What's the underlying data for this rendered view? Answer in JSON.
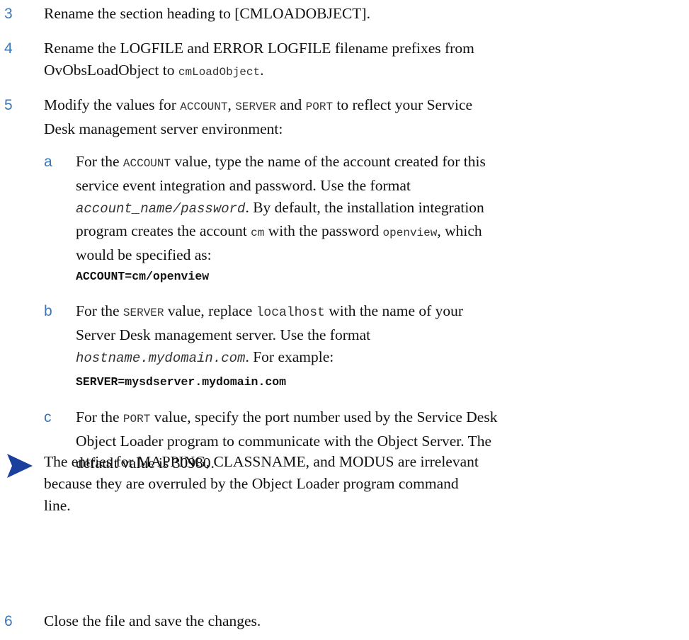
{
  "steps": [
    {
      "number": "3",
      "text_parts": [
        "Rename the section heading to [CMLOADOBJECT]."
      ]
    },
    {
      "number": "4",
      "line1": "Rename the LOGFILE and ERROR LOGFILE filename prefixes from",
      "line2_a": "OvObsLoadObject to ",
      "line2_mono": "cmLoadObject",
      "line2_b": "."
    },
    {
      "number": "5",
      "l1_a": "Modify the values for ",
      "l1_account": "ACCOUNT",
      "l1_b": ", ",
      "l1_server": "SERVER",
      "l1_c": " and ",
      "l1_port": "PORT",
      "l1_d": " to reflect your Service",
      "l2": "Desk management server environment:"
    }
  ],
  "substeps": {
    "a": {
      "letter": "a",
      "l1_a": "For the ",
      "l1_mono": "ACCOUNT",
      "l1_b": " value, type the name of the account created for this",
      "l2": "service event integration and password. Use the format",
      "l3_italic": "account_name/password",
      "l3_b": ". By default, the installation integration",
      "l4_a": "program creates the account ",
      "l4_mono1": "cm",
      "l4_b": " with the password ",
      "l4_mono2": "openview",
      "l4_c": ", which",
      "l5": "would be specified as:",
      "code": "ACCOUNT=cm/openview"
    },
    "b": {
      "letter": "b",
      "l1_a": "For the ",
      "l1_mono": "SERVER",
      "l1_b": " value, replace ",
      "l1_mono2": "localhost",
      "l1_c": " with the name of your",
      "l2": "Server Desk management server. Use the format",
      "l3_italic": "hostname.mydomain.com",
      "l3_b": ". For example:",
      "code": "SERVER=mysdserver.mydomain.com"
    },
    "c": {
      "letter": "c",
      "l1_a": "For the ",
      "l1_mono": "PORT",
      "l1_b": " value, specify the port number used by the Service Desk",
      "l2": "Object Loader program to communicate with the Object Server. The",
      "l3": "default value is 30980."
    }
  },
  "note": {
    "icon": "note-arrow-icon",
    "icon_color": "#1a3f9c",
    "l1": "The entries for MAPPING, CLASSNAME, and MODUS are irrelevant",
    "l2": "because they are overruled by the Object Loader program command",
    "l3": "line."
  },
  "final_step": {
    "number": "6",
    "text": "Close the file and save the changes."
  },
  "accent_color": "#3a76b8"
}
